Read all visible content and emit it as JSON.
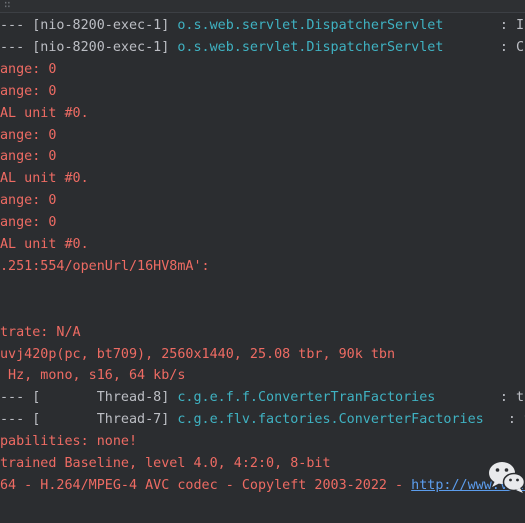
{
  "toolbar": {
    "icon": "menu-dots-icon",
    "glyph": "∷"
  },
  "console": {
    "lines": [
      {
        "segments": [
          {
            "text": "--- [nio-8200-exec-1] ",
            "style": "norm"
          },
          {
            "text": "o.s.web.servlet.DispatcherServlet",
            "style": "cls"
          },
          {
            "text": "       : I",
            "style": "norm"
          }
        ]
      },
      {
        "segments": [
          {
            "text": "--- [nio-8200-exec-1] ",
            "style": "norm"
          },
          {
            "text": "o.s.web.servlet.DispatcherServlet",
            "style": "cls"
          },
          {
            "text": "       : C",
            "style": "norm"
          }
        ]
      },
      {
        "segments": [
          {
            "text": "ange: 0",
            "style": "err"
          }
        ]
      },
      {
        "segments": [
          {
            "text": "ange: 0",
            "style": "err"
          }
        ]
      },
      {
        "segments": [
          {
            "text": "AL unit #0.",
            "style": "err"
          }
        ]
      },
      {
        "segments": [
          {
            "text": "ange: 0",
            "style": "err"
          }
        ]
      },
      {
        "segments": [
          {
            "text": "ange: 0",
            "style": "err"
          }
        ]
      },
      {
        "segments": [
          {
            "text": "AL unit #0.",
            "style": "err"
          }
        ]
      },
      {
        "segments": [
          {
            "text": "ange: 0",
            "style": "err"
          }
        ]
      },
      {
        "segments": [
          {
            "text": "ange: 0",
            "style": "err"
          }
        ]
      },
      {
        "segments": [
          {
            "text": "AL unit #0.",
            "style": "err"
          }
        ]
      },
      {
        "segments": [
          {
            "text": ".251:554/openUrl/16HV8mA':",
            "style": "err"
          }
        ]
      },
      {
        "segments": [
          {
            "text": "",
            "style": "err"
          }
        ]
      },
      {
        "segments": [
          {
            "text": "",
            "style": "err"
          }
        ]
      },
      {
        "segments": [
          {
            "text": "trate: N/A",
            "style": "err"
          }
        ]
      },
      {
        "segments": [
          {
            "text": "uvj420p(pc, bt709), 2560x1440, 25.08 tbr, 90k tbn",
            "style": "err"
          }
        ]
      },
      {
        "segments": [
          {
            "text": " Hz, mono, s16, 64 kb/s",
            "style": "err"
          }
        ]
      },
      {
        "segments": [
          {
            "text": "--- [       Thread-8] ",
            "style": "norm"
          },
          {
            "text": "c.g.e.f.f.ConverterTranFactories",
            "style": "cls"
          },
          {
            "text": "        : t",
            "style": "norm"
          }
        ]
      },
      {
        "segments": [
          {
            "text": "--- [       Thread-7] ",
            "style": "norm"
          },
          {
            "text": "c.g.e.flv.factories.ConverterFactories",
            "style": "cls"
          },
          {
            "text": "   : t",
            "style": "norm"
          }
        ]
      },
      {
        "segments": [
          {
            "text": "pabilities: none!",
            "style": "err"
          }
        ]
      },
      {
        "segments": [
          {
            "text": "trained Baseline, level 4.0, 4:2:0, 8-bit",
            "style": "err"
          }
        ]
      },
      {
        "segments": [
          {
            "text": "64 - H.264/MPEG-4 AVC codec - Copyleft 2003-2022 - ",
            "style": "err"
          },
          {
            "text": "http://www.vide",
            "style": "link"
          }
        ]
      }
    ]
  },
  "watermark": {
    "icon": "wechat-icon",
    "colors": {
      "bubble": "#e9eaec",
      "eyes": "#2b2d30"
    }
  },
  "colors": {
    "background": "#2b2d30",
    "error_text": "#ee6b63",
    "normal_text": "#bcbec4",
    "class_text": "#3fb2c2",
    "link": "#5c9ded"
  }
}
